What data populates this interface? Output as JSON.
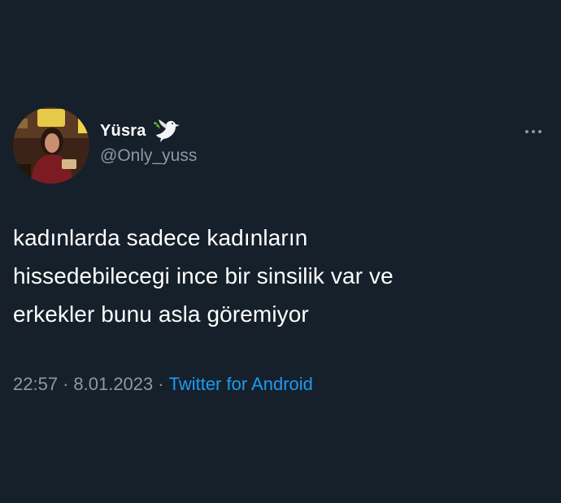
{
  "user": {
    "display_name": "Yüsra",
    "handle": "@Only_yuss",
    "name_emoji_icon": "dove-icon",
    "avatar_icon": "profile-photo"
  },
  "tweet": {
    "lines": [
      "kadınlarda sadece kadınların",
      "hissedebilecegi ince bir sinsilik var ve",
      "erkekler bunu asla göremiyor"
    ],
    "time": "22:57",
    "date": "8.01.2023",
    "separator": "·",
    "source": "Twitter for Android"
  },
  "actions": {
    "more_icon": "more-horizontal-icon"
  },
  "colors": {
    "background": "#15202b",
    "text": "#ffffff",
    "secondary_text": "#8b98a5",
    "link": "#1d9bf0"
  }
}
